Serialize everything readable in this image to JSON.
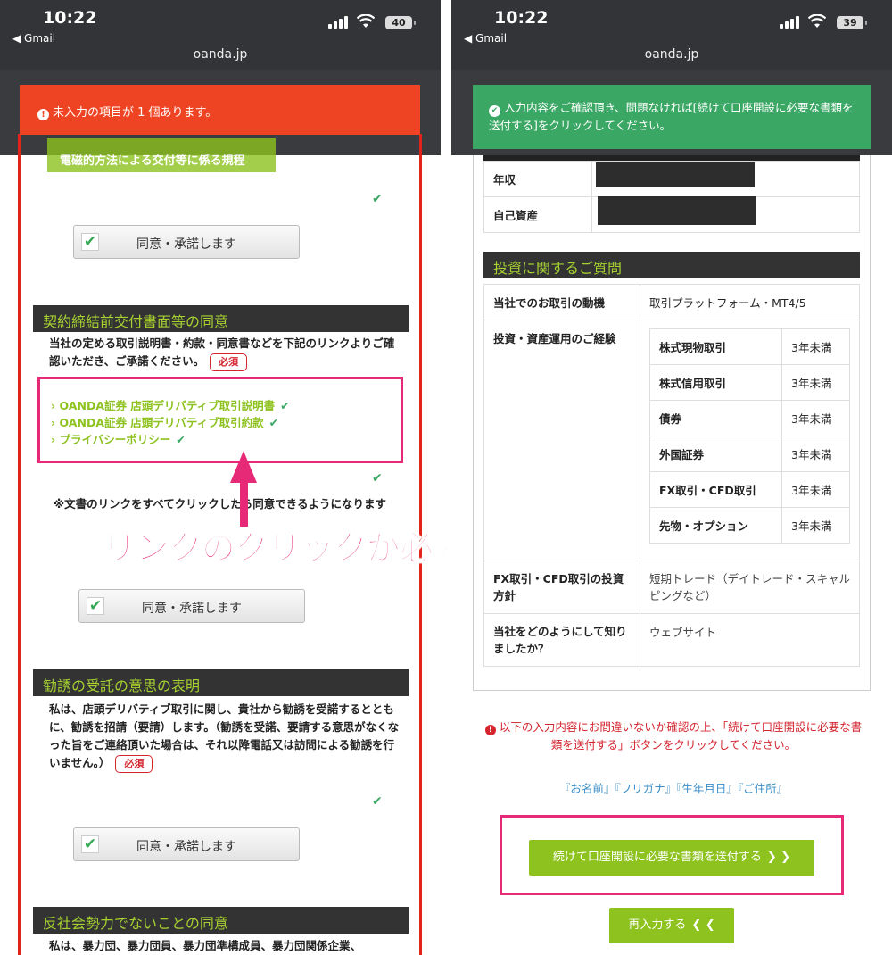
{
  "left": {
    "status": {
      "time": "10:22",
      "back": "◀ Gmail",
      "url": "oanda.jp",
      "battery": "40"
    },
    "alert": "未入力の項目が 1 個あります。",
    "doc_button": "電磁的方法による交付等に係る規程",
    "agree_label": "同意・承諾します",
    "section1": {
      "title": "契約締結前交付書面等の同意",
      "text": "当社の定める取引説明書・約款・同意書などを下記のリンクよりご確認いただき、ご承諾ください。",
      "required": "必須",
      "links": [
        "OANDA証券 店頭デリバティブ取引説明書",
        "OANDA証券 店頭デリバティブ取引約款",
        "プライバシーポリシー"
      ],
      "note": "※文書のリンクをすべてクリックしたら同意できるようになります"
    },
    "annotation": "リンクのクリックが必要",
    "section2": {
      "title": "勧誘の受託の意思の表明",
      "text": "私は、店頭デリバティブ取引に関し、貴社から勧誘を受諾するとともに、勧誘を招請（要請）します。（勧誘を受諾、要請する意思がなくなった旨をご連絡頂いた場合は、それ以降電話又は訪問による勧誘を行いません。）",
      "required": "必須"
    },
    "section3": {
      "title": "反社会勢力でないことの同意",
      "text": "私は、暴力団、暴力団員、暴力団準構成員、暴力団関係企業、"
    }
  },
  "right": {
    "status": {
      "time": "10:22",
      "back": "◀ Gmail",
      "url": "oanda.jp",
      "battery": "39"
    },
    "alert": "入力内容をご確認頂き、問題なければ[続けて口座開設に必要な書類を送付する]をクリックしてください。",
    "asset_rows": [
      {
        "label": "年収"
      },
      {
        "label": "自己資産"
      }
    ],
    "section_title": "投資に関するご質問",
    "motive": {
      "label": "当社でのお取引の動機",
      "value": "取引プラットフォーム・MT4/5"
    },
    "experience": {
      "label": "投資・資産運用のご経験",
      "items": [
        {
          "name": "株式現物取引",
          "value": "3年未満"
        },
        {
          "name": "株式信用取引",
          "value": "3年未満"
        },
        {
          "name": "債券",
          "value": "3年未満"
        },
        {
          "name": "外国証券",
          "value": "3年未満"
        },
        {
          "name": "FX取引・CFD取引",
          "value": "3年未満"
        },
        {
          "name": "先物・オプション",
          "value": "3年未満"
        }
      ]
    },
    "policy": {
      "label": "FX取引・CFD取引の投資方針",
      "value": "短期トレード（デイトレード・スキャルピングなど）"
    },
    "source": {
      "label": "当社をどのようにして知りましたか？",
      "value": "ウェブサイト"
    },
    "error": "以下の入力内容にお間違いないか確認の上、「続けて口座開設に必要な書類を送付する」ボタンをクリックしてください。",
    "fields": "『お名前』『フリガナ』『生年月日』『ご住所』",
    "submit": "続けて口座開設に必要な書類を送付する",
    "reenter": "再入力する"
  }
}
